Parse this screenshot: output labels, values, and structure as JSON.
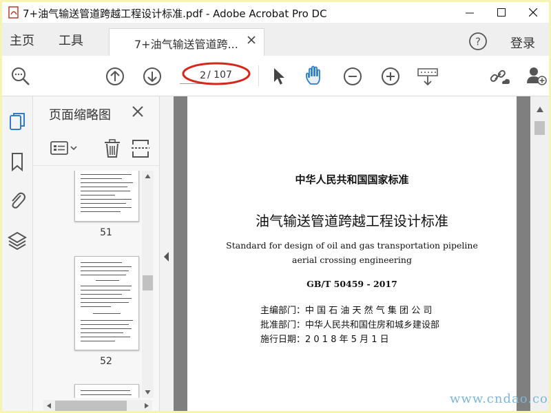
{
  "window": {
    "title": "7+油气输送管道跨越工程设计标准.pdf - Adobe Acrobat Pro DC",
    "controls": [
      "minimize",
      "maximize",
      "close"
    ]
  },
  "menubar": {
    "home_label": "主页",
    "tools_label": "工具",
    "tab_label": "7+油气输送管道跨...",
    "login_label": "登录"
  },
  "toolbar": {
    "current_page": "2",
    "total_pages": "/ 107"
  },
  "thumbnails": {
    "title": "页面缩略图",
    "pages": [
      {
        "number": "51"
      },
      {
        "number": "52"
      }
    ]
  },
  "document": {
    "header": "中华人民共和国国家标准",
    "title": "油气输送管道跨越工程设计标准",
    "english_line1": "Standard for design of oil and gas transportation pipeline",
    "english_line2": "aerial crossing engineering",
    "code": "GB/T 50459 - 2017",
    "editor_line": "主编部门：中 国 石 油 天 然 气 集 团 公 司",
    "approver_line": "批准部门：中华人民共和国住房和城乡建设部",
    "date_line": "施行日期：2 0 1 8 年 5 月 1 日"
  },
  "watermark": "www.cndao.com",
  "colors": {
    "accent_blue": "#2b7bd1",
    "annotation_red": "#d9261c",
    "frame_yellow": "#f5f4b0"
  }
}
